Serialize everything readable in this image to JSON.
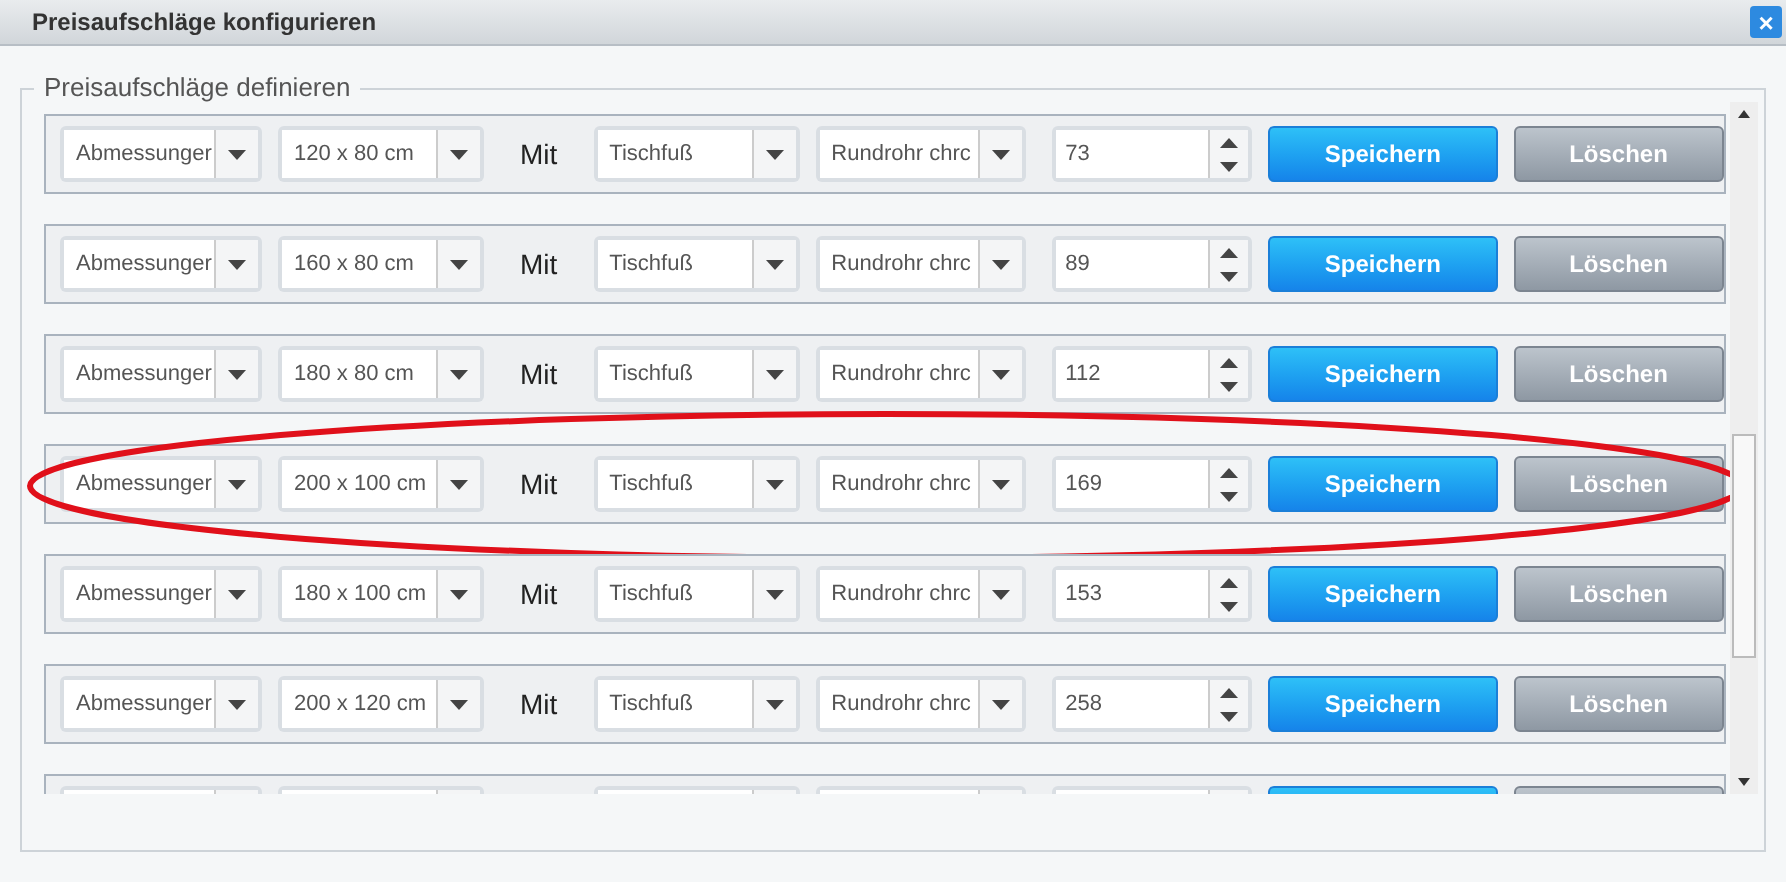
{
  "window": {
    "title": "Preisaufschläge konfigurieren",
    "close_label": "×"
  },
  "fieldset": {
    "legend": "Preisaufschläge definieren"
  },
  "rows": [
    {
      "dimension": "Abmessunger",
      "size": "120 x 80 cm",
      "connector": "Mit",
      "part": "Tischfuß",
      "material": "Rundrohr chrc",
      "price": "73",
      "save": "Speichern",
      "delete": "Löschen",
      "highlighted": false
    },
    {
      "dimension": "Abmessunger",
      "size": "160 x 80 cm",
      "connector": "Mit",
      "part": "Tischfuß",
      "material": "Rundrohr chrc",
      "price": "89",
      "save": "Speichern",
      "delete": "Löschen",
      "highlighted": false
    },
    {
      "dimension": "Abmessunger",
      "size": "180 x 80 cm",
      "connector": "Mit",
      "part": "Tischfuß",
      "material": "Rundrohr chrc",
      "price": "112",
      "save": "Speichern",
      "delete": "Löschen",
      "highlighted": false
    },
    {
      "dimension": "Abmessunger",
      "size": "200 x 100 cm",
      "connector": "Mit",
      "part": "Tischfuß",
      "material": "Rundrohr chrc",
      "price": "169",
      "save": "Speichern",
      "delete": "Löschen",
      "highlighted": true
    },
    {
      "dimension": "Abmessunger",
      "size": "180 x 100 cm",
      "connector": "Mit",
      "part": "Tischfuß",
      "material": "Rundrohr chrc",
      "price": "153",
      "save": "Speichern",
      "delete": "Löschen",
      "highlighted": false
    },
    {
      "dimension": "Abmessunger",
      "size": "200 x 120 cm",
      "connector": "Mit",
      "part": "Tischfuß",
      "material": "Rundrohr chrc",
      "price": "258",
      "save": "Speichern",
      "delete": "Löschen",
      "highlighted": false
    }
  ]
}
